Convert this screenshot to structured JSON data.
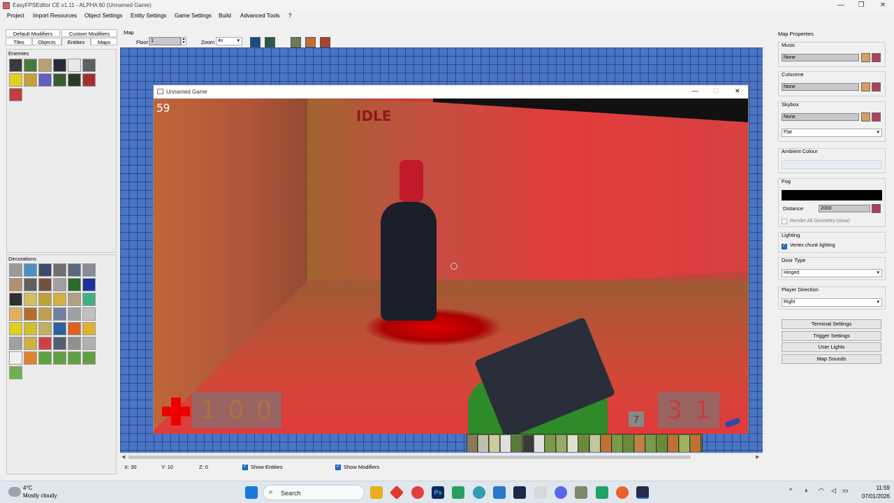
{
  "window": {
    "title": "EasyFPSEditor CE v1.11 - ALPHA 60 (Unnamed Game)",
    "controls": [
      "—",
      "❐",
      "✕"
    ]
  },
  "menu": [
    "Project",
    "Import Resources",
    "Object Settings",
    "Entity Settings",
    "Game Settings",
    "Build",
    "Advanced Tools",
    "?"
  ],
  "left_panel": {
    "tabs_row1": [
      "Default Modifiers",
      "Custom Modifiers"
    ],
    "tabs_row2": [
      "Tiles",
      "Objects",
      "Entities",
      "Maps"
    ],
    "selected_tab": "Entities",
    "enemies_label": "Enemies",
    "decorations_label": "Decorations"
  },
  "map": {
    "label": "Map",
    "floor_label": "Floor",
    "floor_value": "1",
    "zoom_label": "Zoom",
    "zoom_value": "4x",
    "status": {
      "x": "X: 30",
      "y": "Y: 10",
      "z": "Z: 0",
      "show_entities": "Show Entities",
      "show_modifiers": "Show Modifiers"
    }
  },
  "game_window": {
    "title": "Unnamed Game",
    "fps": "59",
    "enemy_state": "IDLE",
    "health_digits": [
      "1",
      "0",
      "0"
    ],
    "ammo_digits": [
      "3",
      "1"
    ],
    "clip_count": "7",
    "controls": [
      "—",
      "☐",
      "✕"
    ]
  },
  "right_panel": {
    "title": "Map Properties",
    "music": {
      "label": "Music",
      "value": "None"
    },
    "cutscene": {
      "label": "Cutscene",
      "value": "None"
    },
    "skybox": {
      "label": "Skybox",
      "value": "None",
      "mode": "Flat"
    },
    "ambient_label": "Ambient Colour",
    "fog": {
      "label": "Fog",
      "distance_label": "Distance",
      "distance_value": "2000",
      "render_all": "Render All Geometry (slow)"
    },
    "lighting": {
      "label": "Lighting",
      "vertex": "Vertex chunk lighting"
    },
    "door_type": {
      "label": "Door Type",
      "value": "Hinged"
    },
    "player_direction": {
      "label": "Player Direction",
      "value": "Right"
    },
    "buttons": [
      "Terminal Settings",
      "Trigger Settings",
      "User Lights",
      "Map Sounds"
    ]
  },
  "taskbar": {
    "temperature": "4°C",
    "weather": "Mostly cloudy",
    "search_placeholder": "Search",
    "time": "11:59",
    "date": "07/01/2026"
  },
  "colors": {
    "map_blue": "#4a74c4",
    "accent_check": "#1a6fd0",
    "health_red": "#e00000"
  }
}
